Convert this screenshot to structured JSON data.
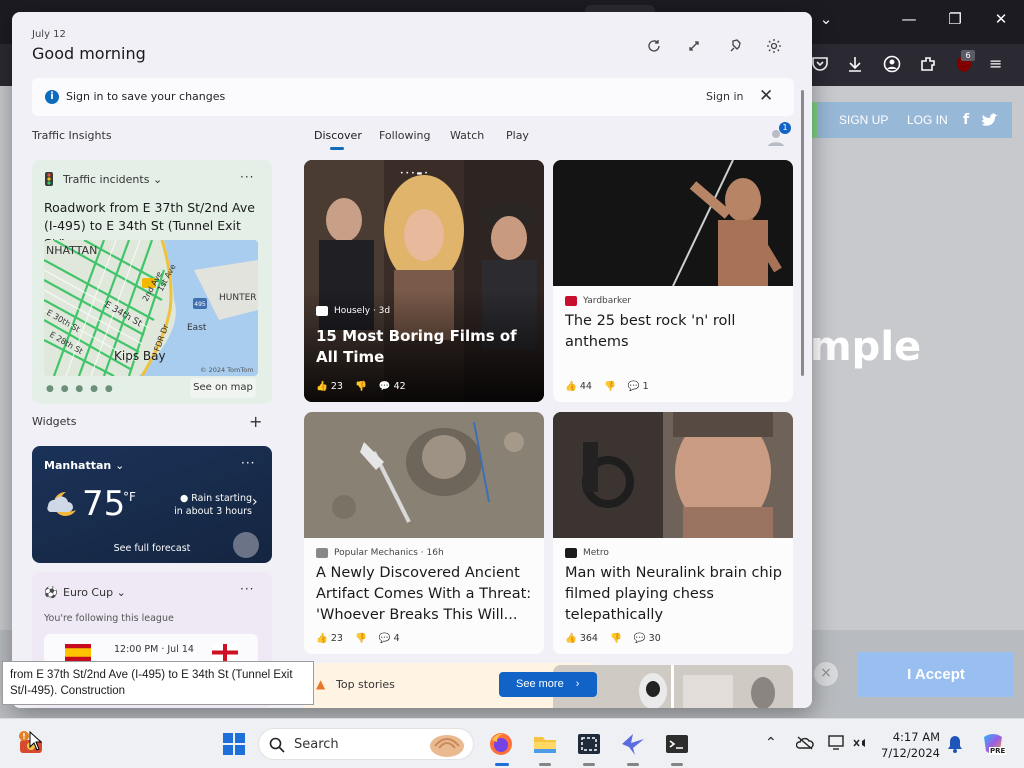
{
  "browser": {
    "tab_badge": "6",
    "nav": {
      "signup": "SIGN UP",
      "login": "LOG IN",
      "fb": "f"
    },
    "hero_text": "mple",
    "cookie": {
      "close": "×",
      "accept_label": "I Accept"
    }
  },
  "widgets": {
    "date": "July 12",
    "greeting": "Good morning",
    "signin_bar": {
      "message": "Sign in to save your changes",
      "link": "Sign in",
      "close": "✕"
    },
    "traffic_insights_title": "Traffic Insights",
    "traffic": {
      "title": "Traffic incidents",
      "more": "···",
      "description": "Roadwork from E 37th St/2nd Ave (I-495) to E 34th St (Tunnel Exit St/I-...",
      "map_labels": {
        "manhattan": "NHATTAN",
        "e34": "E 34th St",
        "e36": "E 36th St",
        "e30": "E 30th St",
        "e28": "E 28th St",
        "e23": "E 23rd St",
        "fdr": "FDR Dr",
        "hunter": "HUNTER",
        "east": "East",
        "kips": "Kips Bay",
        "copyright": "© 2024 TomTom",
        "route": "495",
        "ave2": "2nd Ave",
        "ave1": "1st Ave"
      },
      "pager": "● ● ● ● ●",
      "see_on_map": "See on map"
    },
    "widgets_title": "Widgets",
    "add": "+",
    "weather": {
      "location": "Manhattan",
      "more": "···",
      "temp": "75",
      "unit": "°F",
      "rain": "Rain starting in about 3 hours",
      "arrow": "›",
      "forecast": "See full forecast"
    },
    "euro": {
      "title": "Euro Cup",
      "more": "···",
      "subtitle": "You're following this league",
      "match_time": "12:00 PM · Jul 14"
    },
    "tabs": [
      "Discover",
      "Following",
      "Watch",
      "Play"
    ],
    "avatar_badge": "1",
    "news": [
      {
        "source": "Housely · 3d",
        "headline": "15 Most Boring Films of All Time",
        "likes": "23",
        "comments": "42"
      },
      {
        "source": "Yardbarker",
        "headline": "The 25 best rock 'n' roll anthems",
        "likes": "44",
        "comments": "1"
      },
      {
        "source": "Popular Mechanics · 16h",
        "headline": "A Newly Discovered Ancient Artifact Comes With a Threat: 'Whoever Breaks This Will...",
        "likes": "23",
        "comments": "4"
      },
      {
        "source": "Metro",
        "headline": "Man with Neuralink brain chip filmed playing chess telepathically",
        "likes": "364",
        "comments": "30"
      }
    ],
    "top_stories": "Top stories",
    "see_more": "See more"
  },
  "tooltip": "from E 37th St/2nd Ave (I-495) to E 34th St (Tunnel Exit St/I-495). Construction",
  "taskbar": {
    "search_placeholder": "Search",
    "time": "4:17 AM",
    "date": "7/12/2024",
    "copilot_badge": "PRE"
  }
}
